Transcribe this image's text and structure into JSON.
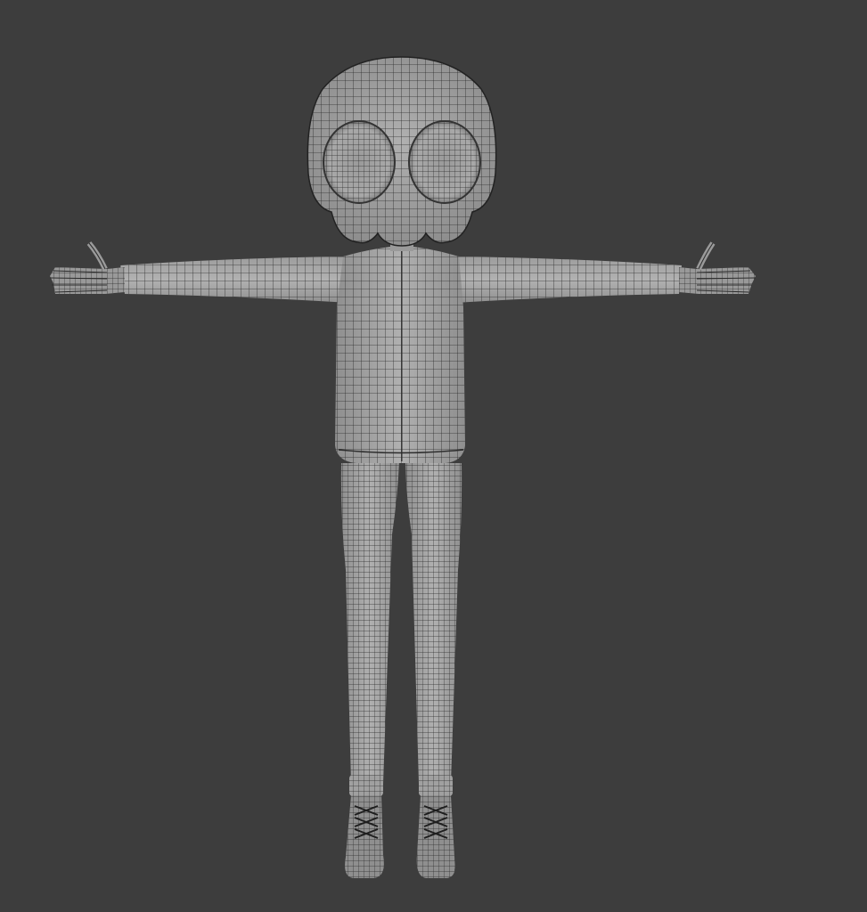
{
  "viewport": {
    "background_color": "#3d3d3d",
    "mesh_fill_color": "#a3a3a3",
    "mesh_shade_color": "#8a8a8a",
    "wire_color": "#2b2b2b",
    "display_mode": "solid-wireframe",
    "view": "front-orthographic"
  },
  "model": {
    "icon": "character-mesh-icon",
    "pose": "t-pose",
    "parts": [
      "skull-head",
      "torso",
      "arms",
      "hands",
      "legs",
      "sneakers"
    ]
  }
}
